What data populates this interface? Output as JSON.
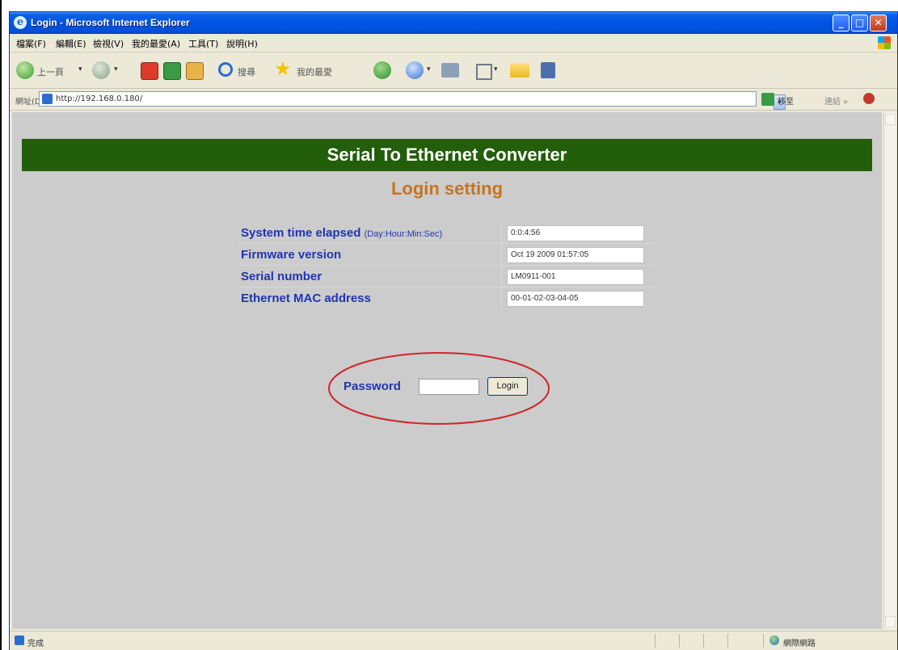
{
  "window": {
    "title": "Login - Microsoft Internet Explorer",
    "minimize_label": "_",
    "maximize_label": "□",
    "close_label": "✕"
  },
  "menu": [
    "檔案(F)",
    "編輯(E)",
    "檢視(V)",
    "我的最愛(A)",
    "工具(T)",
    "說明(H)"
  ],
  "toolbar": {
    "back_label": "上一頁",
    "search_label": "搜尋",
    "favorites_label": "我的最愛",
    "dropdown_glyph": "▾"
  },
  "address": {
    "label": "網址(D)",
    "url": "http://192.168.0.180/",
    "go_label": "移至",
    "links_label": "連結 »"
  },
  "page": {
    "banner": "Serial To Ethernet Converter",
    "heading": "Login setting",
    "rows": [
      {
        "label": "System time elapsed",
        "sublabel": "(Day:Hour:Min:Sec)",
        "value": "0:0:4:56"
      },
      {
        "label": "Firmware version",
        "sublabel": "",
        "value": "Oct 19 2009 01:57:05"
      },
      {
        "label": "Serial number",
        "sublabel": "",
        "value": "LM0911-001"
      },
      {
        "label": "Ethernet MAC address",
        "sublabel": "",
        "value": "00-01-02-03-04-05"
      }
    ],
    "password_label": "Password",
    "password_value": "",
    "login_button": "Login",
    "highlight_color": "#D0252A"
  },
  "status": {
    "text": "完成",
    "zone": "網際網路"
  },
  "colors": {
    "banner_bg": "#235E0A",
    "heading": "#C6741F",
    "label": "#1F35B0",
    "page_bg": "#CCCCCC"
  }
}
